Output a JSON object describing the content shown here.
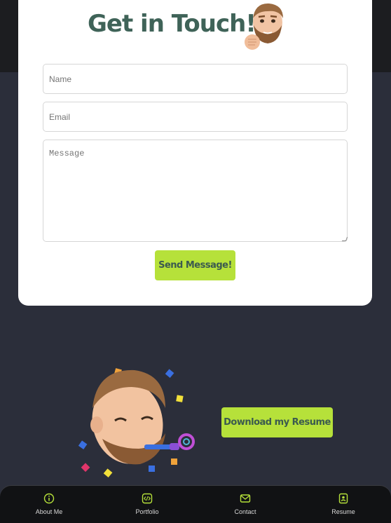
{
  "header": {
    "title": "Get in Touch!"
  },
  "form": {
    "name_placeholder": "Name",
    "email_placeholder": "Email",
    "message_placeholder": "Message",
    "send_label": "Send Message!"
  },
  "resume": {
    "download_label": "Download my Resume"
  },
  "nav": {
    "items": [
      {
        "label": "About Me",
        "icon": "info-icon"
      },
      {
        "label": "Portfolio",
        "icon": "code-icon"
      },
      {
        "label": "Contact",
        "icon": "mail-icon"
      },
      {
        "label": "Resume",
        "icon": "resume-icon"
      }
    ]
  },
  "colors": {
    "accent": "#b6e13a",
    "title": "#3f6358",
    "background": "#2b2e3a",
    "nav_background": "#111214"
  }
}
